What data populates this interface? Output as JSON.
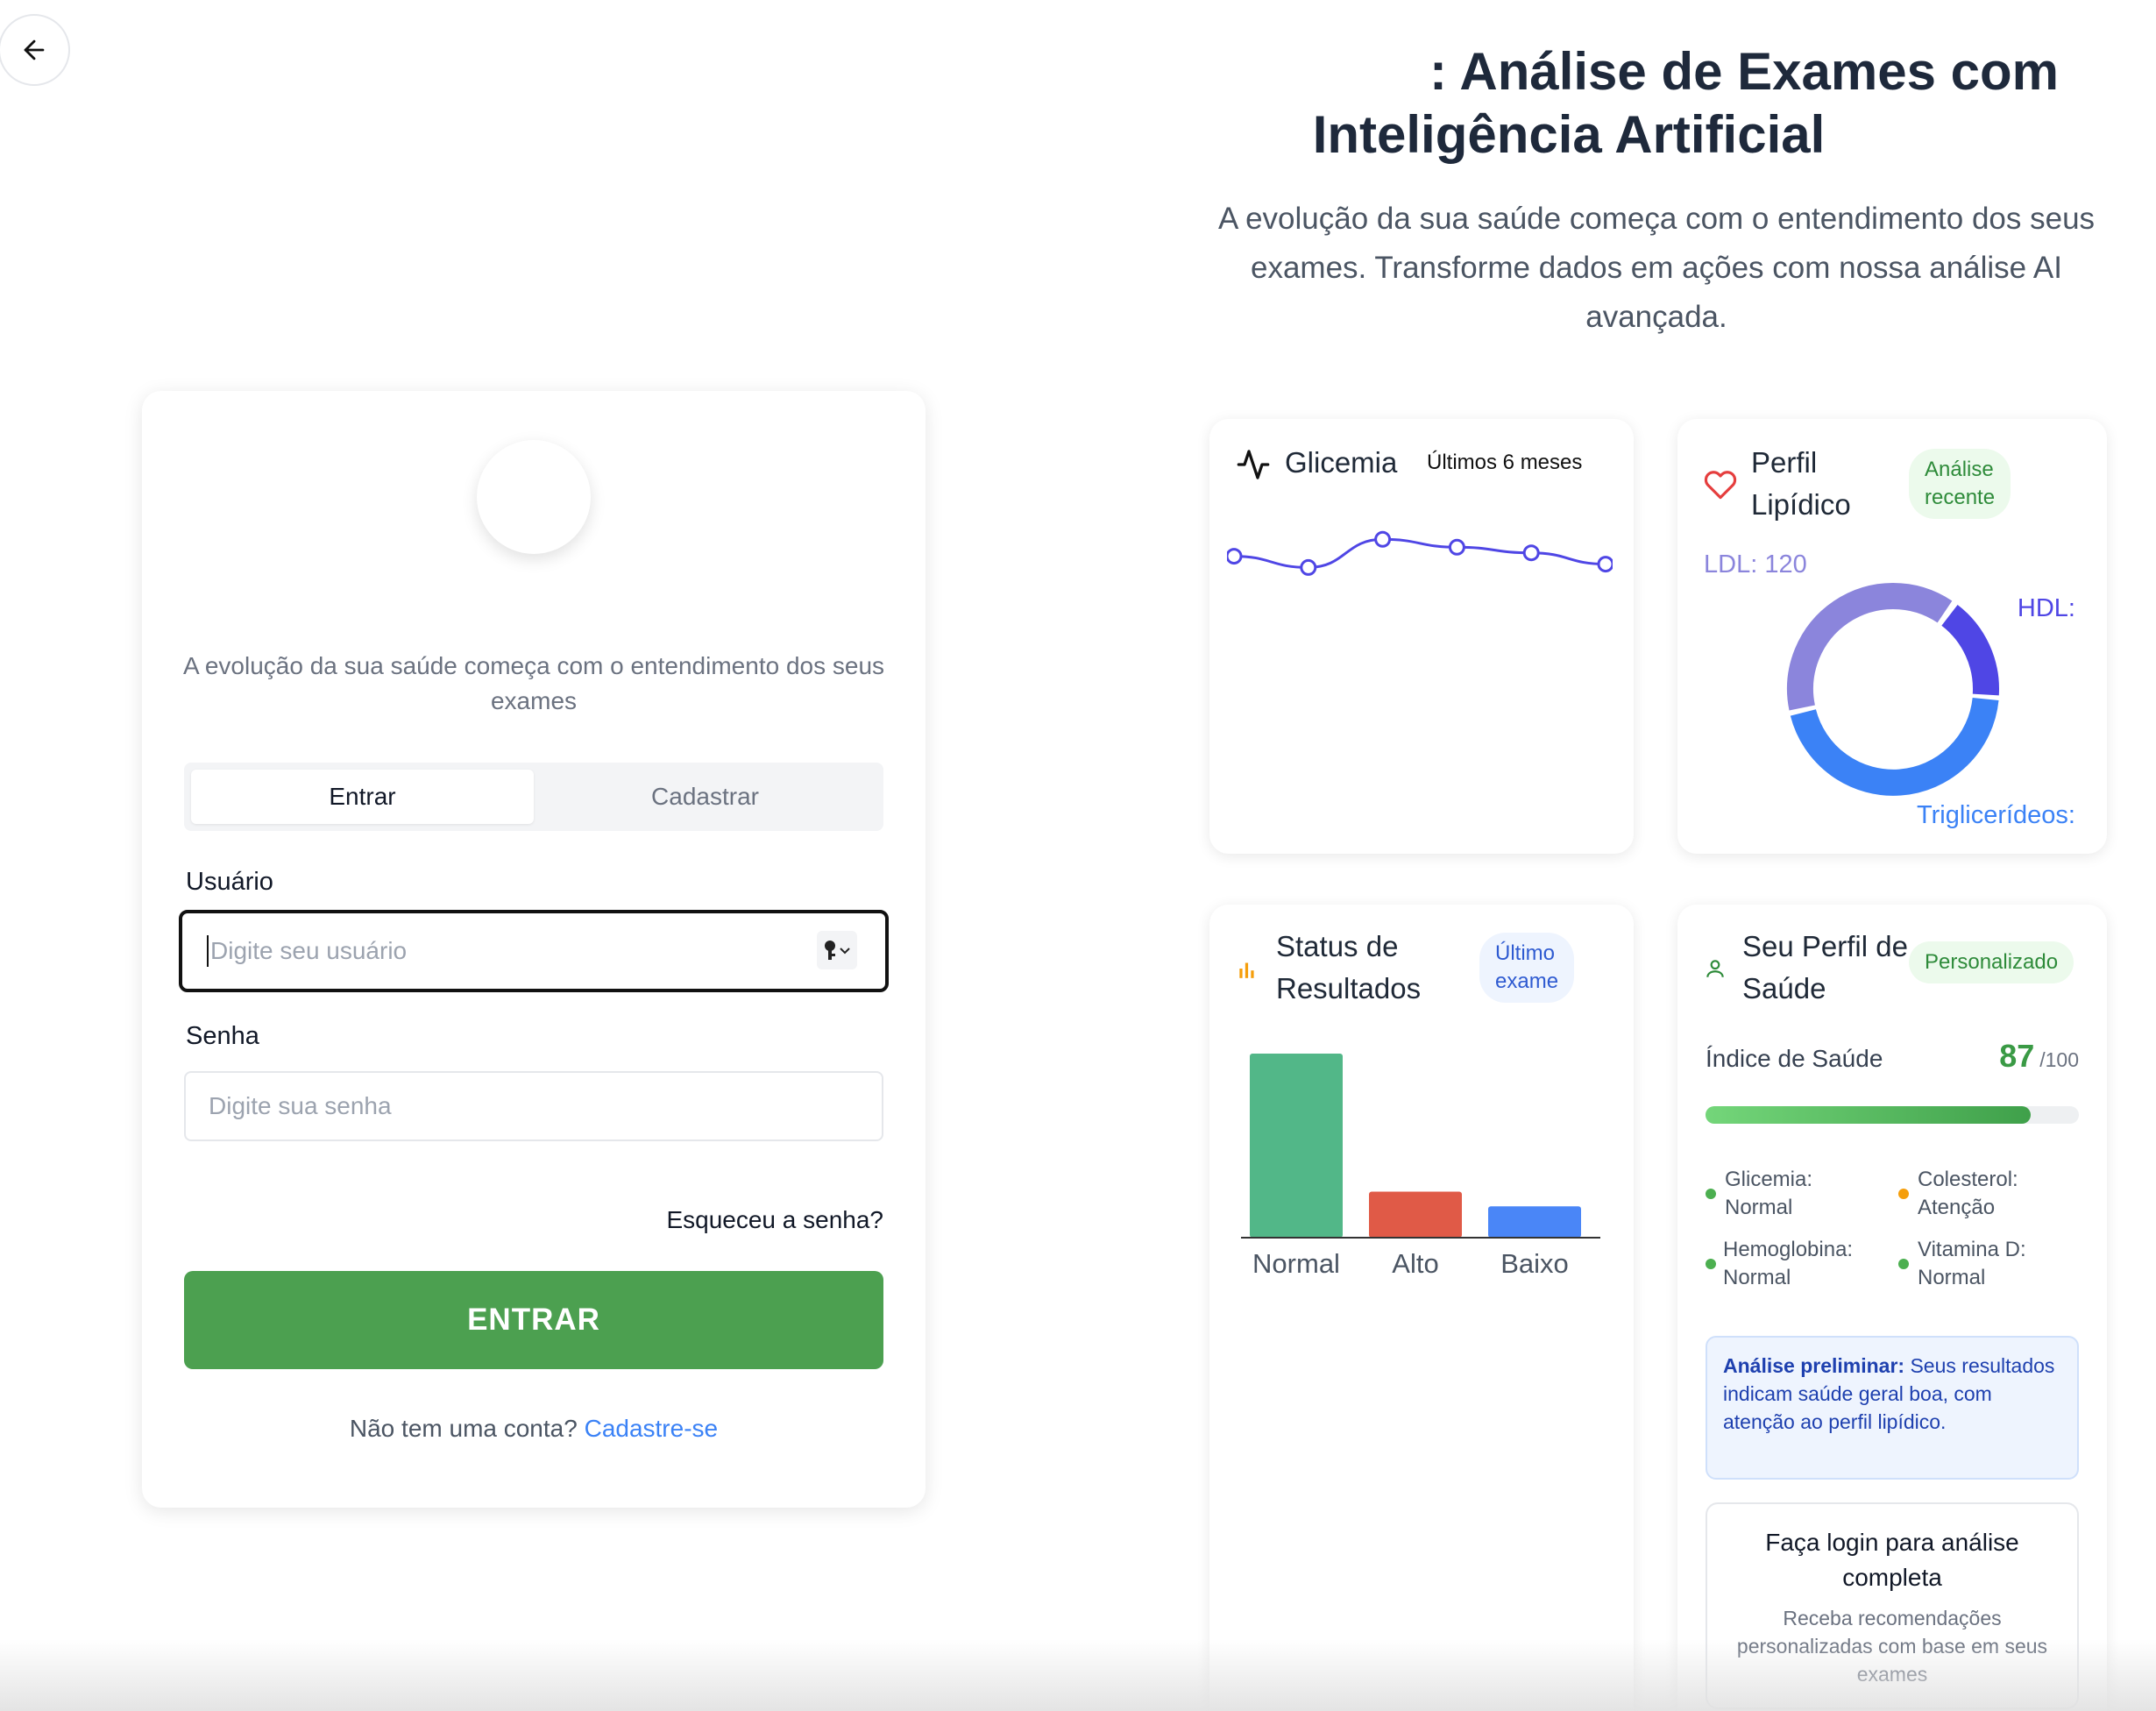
{
  "hero": {
    "title_line1": ": Análise de Exames com",
    "title_line2": "Inteligência Artificial",
    "subtitle": "A evolução da sua saúde começa com o entendimento dos seus exames. Transforme dados em ações com nossa análise AI avançada."
  },
  "login": {
    "tagline": "A evolução da sua saúde começa com o entendimento dos seus exames",
    "tabs": [
      "Entrar",
      "Cadastrar"
    ],
    "user_label": "Usuário",
    "user_placeholder": "Digite seu usuário",
    "password_label": "Senha",
    "password_placeholder": "Digite sua senha",
    "forgot": "Esqueceu a senha?",
    "submit": "ENTRAR",
    "no_account": "Não tem uma conta?",
    "signup_link": "Cadastre-se"
  },
  "glicemia": {
    "title": "Glicemia",
    "period": "Últimos 6 meses",
    "values": [
      40,
      30,
      55,
      48,
      43,
      33
    ]
  },
  "lipid": {
    "title_line1": "Perfil",
    "title_line2": "Lipídico",
    "badge_line1": "Análise",
    "badge_line2": "recente",
    "ldl_label": "LDL: 120",
    "hdl_label": "HDL:",
    "trig_label": "Triglicerídeos:",
    "colors": {
      "ldl": "#8b85dc",
      "hdl": "#4f46e5",
      "trig": "#3b82f6"
    }
  },
  "status": {
    "title_line1": "Status de",
    "title_line2": "Resultados",
    "badge_line1": "Último",
    "badge_line2": "exame",
    "chart_data": {
      "type": "bar",
      "categories": [
        "Normal",
        "Alto",
        "Baixo"
      ],
      "values": [
        100,
        25,
        17
      ],
      "colors": [
        "#52b788",
        "#e05a47",
        "#4a86f7"
      ]
    }
  },
  "profile": {
    "title_line1": "Seu Perfil de",
    "title_line2": "Saúde",
    "badge": "Personalizado",
    "index_label": "Índice de Saúde",
    "score": "87",
    "score_max": "/100",
    "progress": 0.87,
    "items": [
      {
        "name": "Glicemia:",
        "status": "Normal",
        "color": "#4caf50"
      },
      {
        "name": "Colesterol:",
        "status": "Atenção",
        "color": "#f59e0b"
      },
      {
        "name": "Hemoglobina:",
        "status": "Normal",
        "color": "#4caf50"
      },
      {
        "name": "Vitamina D:",
        "status": "Normal",
        "color": "#4caf50"
      }
    ],
    "prelim_bold": "Análise preliminar:",
    "prelim_text": " Seus resultados indicam saúde geral boa, com atenção ao perfil lipídico.",
    "hint_title": "Faça login para análise completa",
    "hint_sub": "Receba recomendações personalizadas com base em seus exames"
  }
}
